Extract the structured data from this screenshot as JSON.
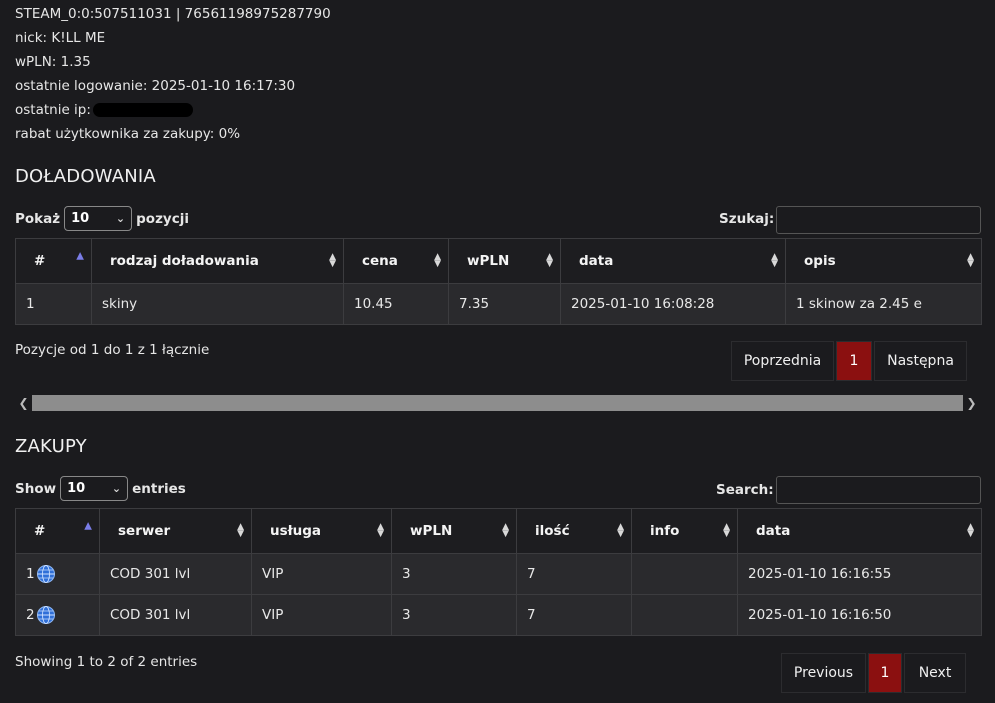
{
  "profile": {
    "steam_id": "STEAM_0:0:507511031 | 76561198975287790",
    "nick": "nick: K!LL ME",
    "wpln": "wPLN: 1.35",
    "last_login": "ostatnie logowanie: 2025-01-10 16:17:30",
    "last_ip_label": "ostatnie ip:",
    "discount": "rabat użytkownika za zakupy: 0%"
  },
  "topups": {
    "heading": "DOŁADOWANIA",
    "show_label": "Pokaż",
    "page_size": "10",
    "show_suffix": "pozycji",
    "search_label": "Szukaj:",
    "columns": [
      "#",
      "rodzaj doładowania",
      "cena",
      "wPLN",
      "data",
      "opis"
    ],
    "rows": [
      [
        "1",
        "skiny",
        "10.45",
        "7.35",
        "2025-01-10 16:08:28",
        "1 skinow za 2.45 e"
      ]
    ],
    "info": "Pozycje od 1 do 1 z 1 łącznie",
    "prev": "Poprzednia",
    "page": "1",
    "next": "Następna"
  },
  "purchases": {
    "heading": "ZAKUPY",
    "show_label": "Show",
    "page_size": "10",
    "show_suffix": "entries",
    "search_label": "Search:",
    "columns": [
      "#",
      "serwer",
      "usługa",
      "wPLN",
      "ilość",
      "info",
      "data"
    ],
    "rows": [
      [
        "1",
        "COD 301 lvl",
        "VIP",
        "3",
        "7",
        "",
        "2025-01-10 16:16:55"
      ],
      [
        "2",
        "COD 301 lvl",
        "VIP",
        "3",
        "7",
        "",
        "2025-01-10 16:16:50"
      ]
    ],
    "info": "Showing 1 to 2 of 2 entries",
    "prev": "Previous",
    "page": "1",
    "next": "Next"
  },
  "icons": {
    "row_icon": "globe-icon",
    "scroll_left": "chevron-left-icon",
    "scroll_right": "chevron-right-icon"
  },
  "colors": {
    "background": "#1b1b1e",
    "cell": "#2a2a2d",
    "active_page": "#8b1010",
    "sort_active": "#7a7de8",
    "scroll_thumb": "#8d8d8d"
  }
}
